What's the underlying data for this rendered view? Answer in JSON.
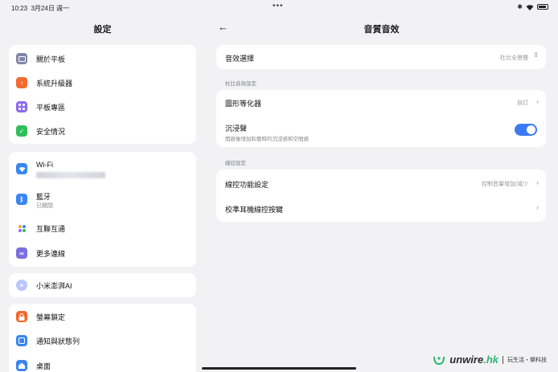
{
  "status_bar": {
    "time": "10:23",
    "date": "3月24日 週一",
    "center_dots": "•••"
  },
  "left_pane": {
    "title": "設定",
    "groups": [
      {
        "items": [
          {
            "label": "關於平板",
            "icon": "tablet-icon",
            "color": "#7f87a8"
          },
          {
            "label": "系統升級器",
            "icon": "upgrade-arrow-icon",
            "color": "#f26a2e"
          },
          {
            "label": "平板專區",
            "icon": "grid-icon",
            "color": "#8b6cf0"
          },
          {
            "label": "安全情況",
            "icon": "shield-check-icon",
            "color": "#2fbf5a"
          }
        ]
      },
      {
        "items": [
          {
            "label": "Wi-Fi",
            "icon": "wifi-icon",
            "color": "#3a86f0"
          },
          {
            "label": "藍牙",
            "sub": "已關閉",
            "icon": "bluetooth-icon",
            "color": "#3a86f0"
          },
          {
            "label": "互聯互通",
            "icon": "interconnect-icon",
            "color": "#e9e4f4"
          },
          {
            "label": "更多連線",
            "icon": "link-icon",
            "color": "#7b6ee0"
          }
        ]
      },
      {
        "items": [
          {
            "label": "小米澎湃AI",
            "icon": "ai-sparkle-icon",
            "color": "#9fb1ff"
          }
        ]
      },
      {
        "items": [
          {
            "label": "螢幕鎖定",
            "icon": "lock-icon",
            "color": "#f26a2e"
          },
          {
            "label": "通知與狀態列",
            "icon": "notification-icon",
            "color": "#3a86f0"
          },
          {
            "label": "桌面",
            "icon": "home-icon",
            "color": "#3a86f0"
          }
        ]
      }
    ]
  },
  "right_pane": {
    "back_glyph": "←",
    "title": "音質音效",
    "effect_select": {
      "label": "音效選擇",
      "value": "杜比全景聲"
    },
    "section1": "杜比音效設定",
    "equalizer": {
      "label": "圖形等化器",
      "value": "自訂"
    },
    "immersive": {
      "label": "沉浸聲",
      "sub": "開啟後增加聆聽時的沉浸感和空間感",
      "on": true
    },
    "section2": "線控設定",
    "wire_function": {
      "label": "線控功能設定",
      "value": "控制音量增加/減少"
    },
    "calibrate": {
      "label": "校準耳機線控按鍵"
    }
  },
  "watermark": {
    "logo_main": "unwire",
    "logo_suffix": ".hk",
    "tagline": "玩生活・樂科技"
  }
}
